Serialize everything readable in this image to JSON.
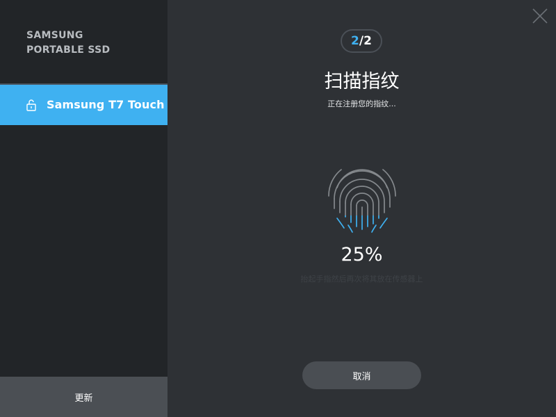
{
  "sidebar": {
    "brand_line1": "SAMSUNG",
    "brand_line2": "PORTABLE SSD",
    "device": {
      "label": "Samsung T7 Touch",
      "icon": "unlock-icon"
    },
    "update_label": "更新"
  },
  "window": {
    "close_icon": "close-icon"
  },
  "main": {
    "step": {
      "current": "2",
      "separator": "/",
      "total": "2"
    },
    "title": "扫描指纹",
    "subtitle": "正在注册您的指纹...",
    "fingerprint_icon": "fingerprint-icon",
    "progress": {
      "percent_text": "25%",
      "value": 0.25
    },
    "hint": "抬起手指然后再次将其放在传感器上",
    "cancel_label": "取消"
  },
  "colors": {
    "accent": "#3fb1f1",
    "sidebar_bg": "#222528",
    "main_bg": "#2e3135",
    "button_bg": "#4a4e53",
    "fingerprint_idle": "#85898d"
  }
}
